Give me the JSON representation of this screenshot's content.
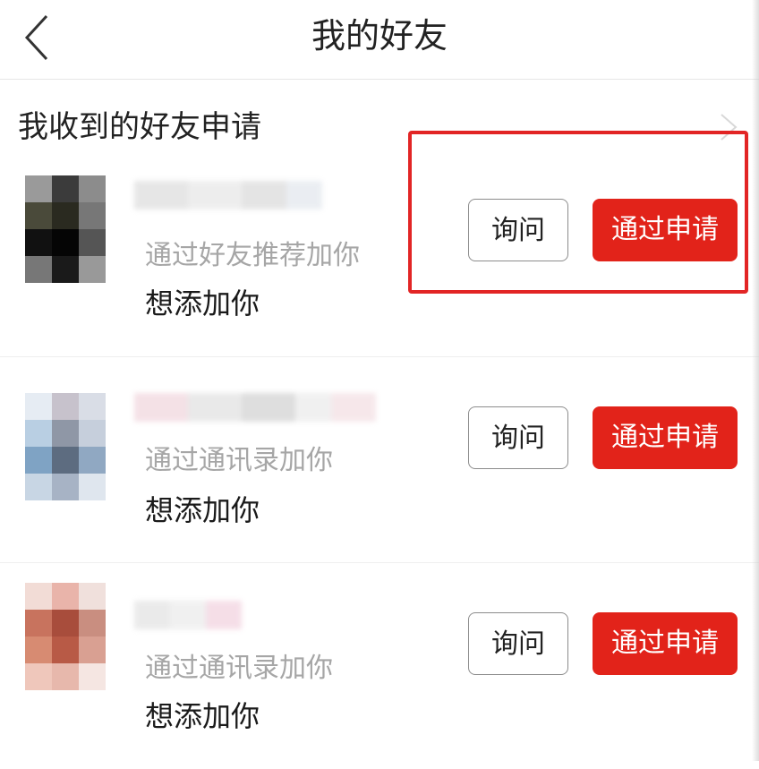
{
  "header": {
    "title": "我的好友",
    "back_icon": "chevron-left-icon"
  },
  "section": {
    "title": "我收到的好友申请",
    "arrow_icon": "chevron-right-icon"
  },
  "requests": [
    {
      "source": "通过好友推荐加你",
      "message": "想添加你",
      "ask_label": "询问",
      "accept_label": "通过申请",
      "highlighted": true
    },
    {
      "source": "通过通讯录加你",
      "message": "想添加你",
      "ask_label": "询问",
      "accept_label": "通过申请",
      "highlighted": false
    },
    {
      "source": "通过通讯录加你",
      "message": "想添加你",
      "ask_label": "询问",
      "accept_label": "通过申请",
      "highlighted": false
    }
  ],
  "colors": {
    "accent_red": "#e2231a",
    "highlight_border": "#e22525",
    "secondary_text": "#a6a6a6"
  }
}
